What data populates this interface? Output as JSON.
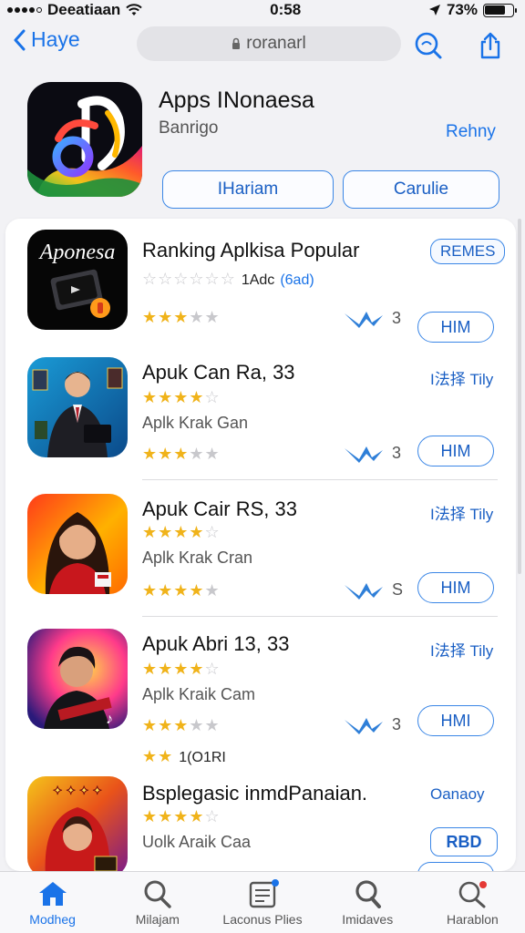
{
  "status_bar": {
    "carrier": "Deeatiaan",
    "time": "0:58",
    "battery": "73%",
    "battery_level": 0.73
  },
  "nav": {
    "back_label": "Haye",
    "search_text": "roranarl"
  },
  "header_app": {
    "title": "Apps INonaesa",
    "subtitle": "Banrigo",
    "link": "Rehny",
    "button_1": "IHariam",
    "button_2": "Carulie"
  },
  "rows": [
    {
      "icon_text": "Aponesa",
      "title": "Ranking Aplkisa Popular",
      "stars_primary": {
        "count": "1Adc",
        "paren": "(6ad)"
      },
      "tag": "REMES",
      "meta_count": "3",
      "button": "HIM"
    },
    {
      "title": "Apuk Can Ra, 33",
      "tag": "I法择 Tily",
      "sub": "Aplk Krak Gan",
      "meta_count": "3",
      "button": "HIM"
    },
    {
      "title": "Apuk Cair RS, 33",
      "tag": "I法择 Tily",
      "sub": "Aplk Krak Cran",
      "meta_count": "S",
      "button": "HIM"
    },
    {
      "title": "Apuk Abri 13, 33",
      "tag": "I法择 Tily",
      "sub": "Aplk Kraik Cam",
      "meta_count": "3",
      "button": "HMI",
      "extra_rating": "1(O1RI"
    },
    {
      "title": "Bsplegasic inmdPanaian.",
      "tag": "Oanaoy",
      "sub": "Uolk Araik Caa",
      "button": "RBD"
    }
  ],
  "tabs": [
    {
      "label": "Modheg",
      "icon": "home-icon",
      "active": true
    },
    {
      "label": "Milajam",
      "icon": "search-icon",
      "active": false
    },
    {
      "label": "Laconus Plies",
      "icon": "document-icon",
      "active": false
    },
    {
      "label": "Imidaves",
      "icon": "magnifier-icon",
      "active": false
    },
    {
      "label": "Harablon",
      "icon": "search-icon",
      "active": false
    }
  ],
  "colors": {
    "accent": "#1a73e8",
    "star": "#f0b31a",
    "badge_red": "#e53935"
  }
}
